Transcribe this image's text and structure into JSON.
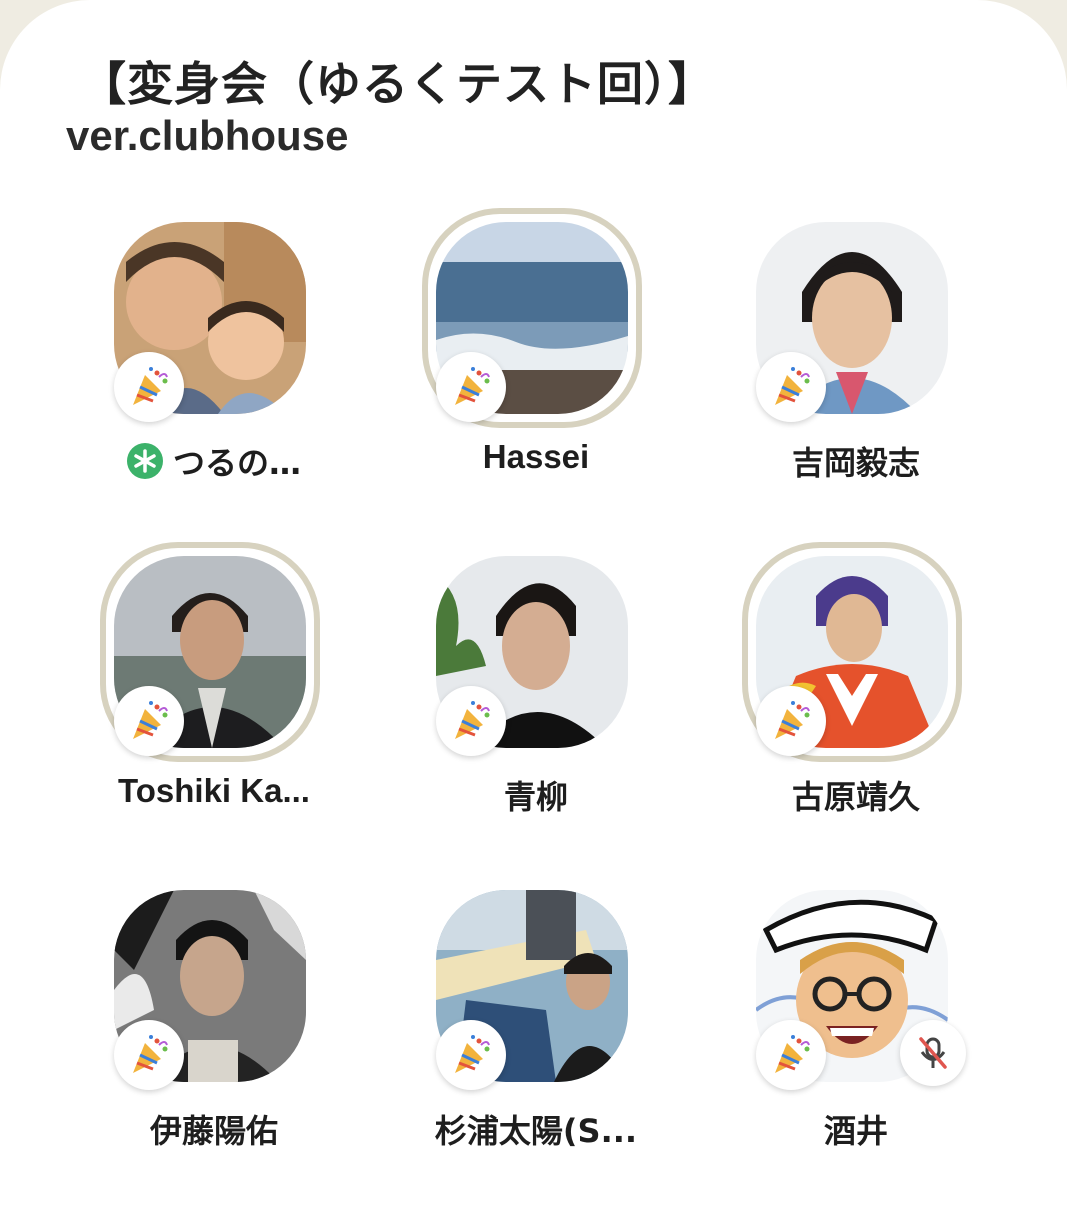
{
  "room": {
    "title": "【変身会（ゆるくテスト回）】",
    "subtitle": "ver.clubhouse"
  },
  "speakers": [
    {
      "name": "つるの…",
      "moderator": true,
      "speaking_ring": false,
      "muted": false,
      "badge_icon": "party-popper-icon"
    },
    {
      "name": "Hassei",
      "moderator": false,
      "speaking_ring": true,
      "muted": false,
      "badge_icon": "party-popper-icon"
    },
    {
      "name": "吉岡毅志",
      "moderator": false,
      "speaking_ring": false,
      "muted": false,
      "badge_icon": "party-popper-icon"
    },
    {
      "name": "Toshiki Ka...",
      "moderator": false,
      "speaking_ring": true,
      "muted": false,
      "badge_icon": "party-popper-icon"
    },
    {
      "name": "青柳",
      "moderator": false,
      "speaking_ring": false,
      "muted": false,
      "badge_icon": "party-popper-icon"
    },
    {
      "name": "古原靖久",
      "moderator": false,
      "speaking_ring": true,
      "muted": false,
      "badge_icon": "party-popper-icon"
    },
    {
      "name": "伊藤陽佑",
      "moderator": false,
      "speaking_ring": false,
      "muted": false,
      "badge_icon": "party-popper-icon"
    },
    {
      "name": "杉浦太陽(S...",
      "moderator": false,
      "speaking_ring": false,
      "muted": false,
      "badge_icon": "party-popper-icon"
    },
    {
      "name": "酒井",
      "moderator": false,
      "speaking_ring": false,
      "muted": true,
      "badge_icon": "party-popper-icon"
    }
  ],
  "colors": {
    "background": "#efece2",
    "card": "#ffffff",
    "speaking_ring": "#d7d2bf",
    "moderator_icon": "#3cb26a",
    "mute_slash": "#e0564f"
  }
}
